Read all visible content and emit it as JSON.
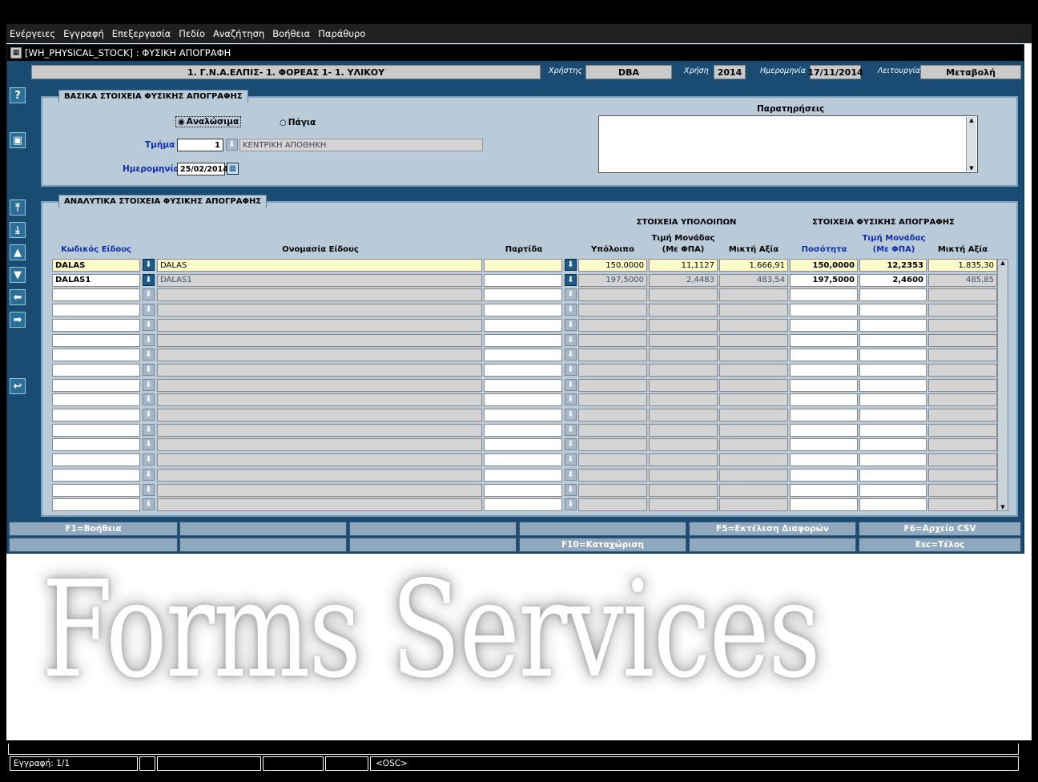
{
  "menu": [
    "Ενέργειες",
    "Εγγραφή",
    "Επεξεργασία",
    "Πεδίο",
    "Αναζήτηση",
    "Βοήθεια",
    "Παράθυρο"
  ],
  "window_title": "[WH_PHYSICAL_STOCK]  :  ΦΥΣΙΚΗ ΑΠΟΓΡΑΦΗ",
  "header": {
    "org": "1. Γ.Ν.Α.ΕΛΠΙΣ- 1. ΦΟΡΕΑΣ 1- 1. ΥΛΙΚΟΥ",
    "user_label": "Χρήστης",
    "user": "DBA",
    "year_label": "Χρήση",
    "year": "2014",
    "date_label": "Ημερομηνία",
    "date": "17/11/2014",
    "mode_label": "Λειτουργία",
    "mode": "Μεταβολή"
  },
  "basic": {
    "title": "ΒΑΣΙΚΑ ΣΤΟΙΧΕΙΑ ΦΥΣΙΚΗΣ ΑΠΟΓΡΑΦΗΣ",
    "radio_consumables": "Αναλώσιμα",
    "radio_fixed": "Πάγια",
    "dept_label": "Τμήμα",
    "dept_code": "1",
    "dept_name": "ΚΕΝΤΡΙΚΗ ΑΠΟΘΗΚΗ",
    "date_label": "Ημερομηνία",
    "date": "25/02/2014",
    "notes_label": "Παρατηρήσεις"
  },
  "details": {
    "title": "ΑΝΑΛΥΤΙΚΑ ΣΤΟΙΧΕΙΑ ΦΥΣΙΚΗΣ ΑΠΟΓΡΑΦΗΣ",
    "group_balance": "ΣΤΟΙΧΕΙΑ ΥΠΟΛΟΙΠΩΝ",
    "group_physical": "ΣΤΟΙΧΕΙΑ ΦΥΣΙΚΗΣ ΑΠΟΓΡΑΦΗΣ",
    "col_code": "Κωδικός Είδους",
    "col_name": "Ονομασία Είδους",
    "col_batch": "Παρτίδα",
    "col_balance": "Υπόλοιπο",
    "col_unit_price_1": "Τιμή Μονάδας",
    "col_unit_price_2": "(Με ΦΠΑ)",
    "col_gross": "Μικτή Αξία",
    "col_qty": "Ποσότητα",
    "col_unit_price2_1": "Τιμή Μονάδας",
    "col_unit_price2_2": "(Με ΦΠΑ)",
    "col_gross2": "Μικτή Αξία",
    "rows": [
      {
        "code": "DALAS",
        "name": "DALAS",
        "batch": "",
        "balance": "150,0000",
        "price": "11,1127",
        "gross": "1.666,91",
        "qty": "150,0000",
        "price2": "12,2353",
        "gross2": "1.835,30"
      },
      {
        "code": "DALAS1",
        "name": "DALAS1",
        "batch": "",
        "balance": "197,5000",
        "price": "2,4483",
        "gross": "483,54",
        "qty": "197,5000",
        "price2": "2,4600",
        "gross2": "485,85"
      }
    ],
    "empty_rows": 15
  },
  "fkeys": {
    "f1": "F1=Βοήθεια",
    "f5": "F5=Εκτέλεση Διαφορών",
    "f6": "F6=Αρχείο CSV",
    "f10": "F10=Καταχώριση",
    "esc": "Esc=Τέλος"
  },
  "watermark": "Forms Services",
  "status": {
    "record": "Εγγραφή: 1/1",
    "osc": "<OSC>"
  }
}
